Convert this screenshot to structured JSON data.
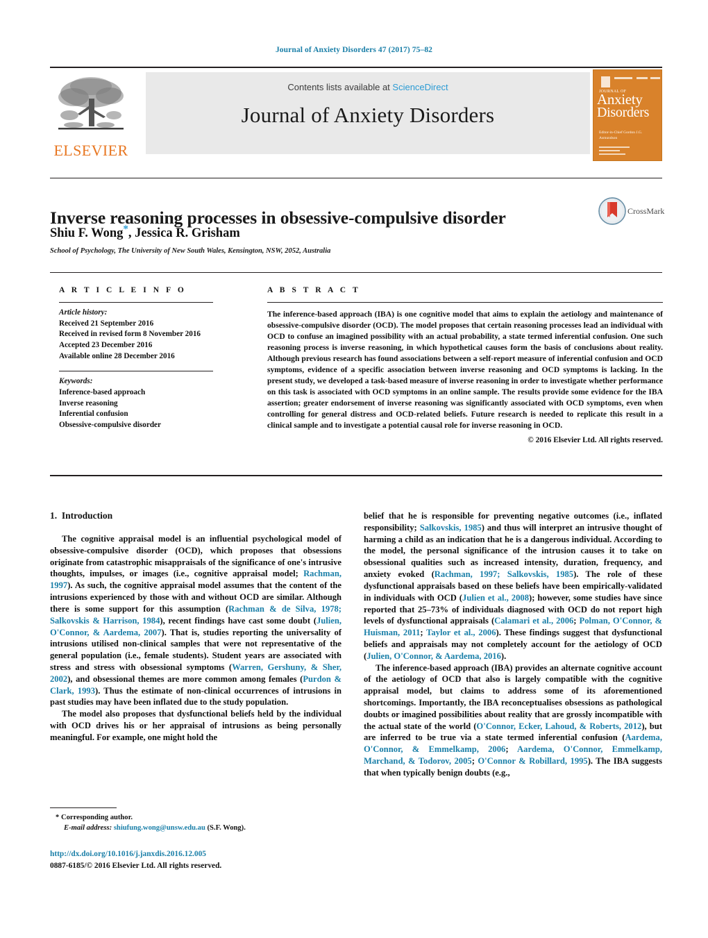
{
  "running_head": "Journal of Anxiety Disorders 47 (2017) 75–82",
  "masthead": {
    "contents_prefix": "Contents lists available at ",
    "sciencedirect": "ScienceDirect",
    "journal_name": "Journal of Anxiety Disorders",
    "publisher_wordmark": "ELSEVIER",
    "publisher_logo_icon": "elsevier-tree-icon",
    "cover": {
      "journal_of": "JOURNAL OF",
      "line1": "Anxiety",
      "line2": "Disorders",
      "sub": "Editor-in-Chief\nGordon J.G. Asmundson"
    },
    "accent_orange": "#e87722",
    "accent_blue": "#2b9bd4",
    "banner_bg": "#e9e9e9"
  },
  "article": {
    "title": "Inverse reasoning processes in obsessive-compulsive disorder",
    "authors": "Shiu F. Wong",
    "authors_rest": ", Jessica R. Grisham",
    "corresponding_marker": "*",
    "affiliation": "School of Psychology, The University of New South Wales, Kensington, NSW, 2052, Australia",
    "crossmark_label": "CrossMark",
    "crossmark_icon": "crossmark-logo-icon"
  },
  "info": {
    "heading": "A R T I C L E   I N F O",
    "history_label": "Article history:",
    "history": [
      "Received 21 September 2016",
      "Received in revised form 8 November 2016",
      "Accepted 23 December 2016",
      "Available online 28 December 2016"
    ],
    "keywords_label": "Keywords:",
    "keywords": [
      "Inference-based approach",
      "Inverse reasoning",
      "Inferential confusion",
      "Obsessive-compulsive disorder"
    ]
  },
  "abstract": {
    "heading": "A B S T R A C T",
    "text": "The inference-based approach (IBA) is one cognitive model that aims to explain the aetiology and maintenance of obsessive-compulsive disorder (OCD). The model proposes that certain reasoning processes lead an individual with OCD to confuse an imagined possibility with an actual probability, a state termed inferential confusion. One such reasoning process is inverse reasoning, in which hypothetical causes form the basis of conclusions about reality. Although previous research has found associations between a self-report measure of inferential confusion and OCD symptoms, evidence of a specific association between inverse reasoning and OCD symptoms is lacking. In the present study, we developed a task-based measure of inverse reasoning in order to investigate whether performance on this task is associated with OCD symptoms in an online sample. The results provide some evidence for the IBA assertion; greater endorsement of inverse reasoning was significantly associated with OCD symptoms, even when controlling for general distress and OCD-related beliefs. Future research is needed to replicate this result in a clinical sample and to investigate a potential causal role for inverse reasoning in OCD.",
    "copyright": "© 2016 Elsevier Ltd. All rights reserved."
  },
  "body": {
    "section_number": "1.",
    "section_title": "Introduction",
    "left_paragraph_1_a": "The cognitive appraisal model is an influential psychological model of obsessive-compulsive disorder (OCD), which proposes that obsessions originate from catastrophic misappraisals of the significance of one's intrusive thoughts, impulses, or images (i.e., cognitive appraisal model; ",
    "left_cite_1": "Rachman, 1997",
    "left_paragraph_1_b": "). As such, the cognitive appraisal model assumes that the content of the intrusions experienced by those with and without OCD are similar. Although there is some support for this assumption (",
    "left_cite_2": "Rachman & de Silva, 1978; Salkovskis & Harrison, 1984",
    "left_paragraph_1_c": "), recent findings have cast some doubt (",
    "left_cite_3": "Julien, O'Connor, & Aardema, 2007",
    "left_paragraph_1_d": "). That is, studies reporting the universality of intrusions utilised non-clinical samples that were not representative of the general population (i.e., female students). Student years are associated with stress and stress with obsessional symptoms (",
    "left_cite_4": "Warren, Gershuny, & Sher, 2002",
    "left_paragraph_1_e": "), and obsessional themes are more common among females (",
    "left_cite_5": "Purdon & Clark, 1993",
    "left_paragraph_1_f": "). Thus the estimate of non-clinical occurrences of intrusions in past studies may have been inflated due to the study population.",
    "left_paragraph_2": "The model also proposes that dysfunctional beliefs held by the individual with OCD drives his or her appraisal of intrusions as being personally meaningful. For example, one might hold the",
    "right_paragraph_1_a": "belief that he is responsible for preventing negative outcomes (i.e., inflated responsibility; ",
    "right_cite_1": "Salkovskis, 1985",
    "right_paragraph_1_b": ") and thus will interpret an intrusive thought of harming a child as an indication that he is a dangerous individual. According to the model, the personal significance of the intrusion causes it to take on obsessional qualities such as increased intensity, duration, frequency, and anxiety evoked (",
    "right_cite_2": "Rachman, 1997; Salkovskis, 1985",
    "right_paragraph_1_c": "). The role of these dysfunctional appraisals based on these beliefs have been empirically-validated in individuals with OCD (",
    "right_cite_3": "Julien et al., 2008",
    "right_paragraph_1_d": "); however, some studies have since reported that 25–73% of individuals diagnosed with OCD do not report high levels of dysfunctional appraisals (",
    "right_cite_4": "Calamari et al., 2006",
    "right_paragraph_1_e": "; ",
    "right_cite_5": "Polman, O'Connor, & Huisman, 2011",
    "right_paragraph_1_f": "; ",
    "right_cite_6": "Taylor et al., 2006",
    "right_paragraph_1_g": "). These findings suggest that dysfunctional beliefs and appraisals may not completely account for the aetiology of OCD (",
    "right_cite_7": "Julien, O'Connor, & Aardema, 2016",
    "right_paragraph_1_h": ").",
    "right_paragraph_2_a": "The inference-based approach (IBA) provides an alternate cognitive account of the aetiology of OCD that also is largely compatible with the cognitive appraisal model, but claims to address some of its aforementioned shortcomings. Importantly, the IBA reconceptualises obsessions as pathological doubts or imagined possibilities about reality that are grossly incompatible with the actual state of the world (",
    "right_cite_8": "O'Connor, Ecker, Lahoud, & Roberts, 2012",
    "right_paragraph_2_b": "), but are inferred to be true via a state termed inferential confusion (",
    "right_cite_9": "Aardema, O'Connor, & Emmelkamp, 2006",
    "right_paragraph_2_c": "; ",
    "right_cite_10": "Aardema, O'Connor, Emmelkamp, Marchand, & Todorov, 2005",
    "right_paragraph_2_d": "; ",
    "right_cite_11": "O'Connor & Robillard, 1995",
    "right_paragraph_2_e": "). The IBA suggests that when typically benign doubts (e.g.,"
  },
  "footer": {
    "corresponding_marker": "*",
    "corresponding_label": "Corresponding author.",
    "email_label": "E-mail address:",
    "email": "shiufung.wong@unsw.edu.au",
    "email_suffix": "(S.F. Wong).",
    "doi": "http://dx.doi.org/10.1016/j.janxdis.2016.12.005",
    "issn_line": "0887-6185/© 2016 Elsevier Ltd. All rights reserved."
  },
  "colors": {
    "link_blue": "#1a7fa8",
    "sciencedirect_blue": "#2b9bd4",
    "elsevier_orange": "#e87722",
    "cover_orange": "#d9822b"
  }
}
